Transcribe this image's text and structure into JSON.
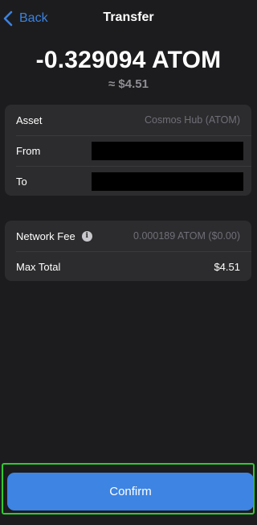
{
  "nav": {
    "back_label": "Back",
    "title": "Transfer"
  },
  "summary": {
    "amount": "-0.329094 ATOM",
    "fiat": "≈ $4.51"
  },
  "details": {
    "asset_label": "Asset",
    "asset_value": "Cosmos Hub (ATOM)",
    "from_label": "From",
    "to_label": "To"
  },
  "fees": {
    "network_fee_label": "Network Fee",
    "network_fee_value": "0.000189 ATOM ($0.00)",
    "max_total_label": "Max Total",
    "max_total_value": "$4.51"
  },
  "confirm_label": "Confirm",
  "colors": {
    "background": "#1c1c1e",
    "card": "#2c2c2e",
    "accent": "#3d84e3",
    "muted_text": "#8e8e93"
  }
}
